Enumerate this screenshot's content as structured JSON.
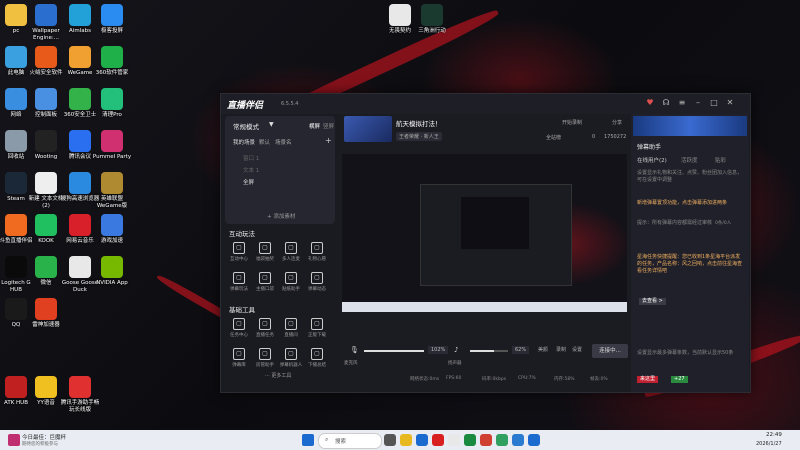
{
  "desktop": {
    "icons": [
      {
        "label": "pc",
        "icon": "folder-icon",
        "color": "#f0c040"
      },
      {
        "label": "Wallpaper Engine:...",
        "icon": "wallpaper-engine-icon",
        "color": "#2a6fd0"
      },
      {
        "label": "Aimlabs",
        "icon": "aimlabs-icon",
        "color": "#22a0d8"
      },
      {
        "label": "极客投屏",
        "icon": "screencast-icon",
        "color": "#2a8cf0"
      },
      {
        "label": "此电脑",
        "icon": "computer-icon",
        "color": "#3aa0e0"
      },
      {
        "label": "火绒安全软件",
        "icon": "huorong-icon",
        "color": "#e85a1a"
      },
      {
        "label": "WeGame",
        "icon": "wegame-icon",
        "color": "#f0a030"
      },
      {
        "label": "360软件管家",
        "icon": "360-manager-icon",
        "color": "#1fb04a"
      },
      {
        "label": "网络",
        "icon": "network-icon",
        "color": "#3a8ee0"
      },
      {
        "label": "控制面板",
        "icon": "control-panel-icon",
        "color": "#4a90e2"
      },
      {
        "label": "360安全卫士",
        "icon": "360-security-icon",
        "color": "#33b24a"
      },
      {
        "label": "清理Pro",
        "icon": "cleaner-icon",
        "color": "#22c07a"
      },
      {
        "label": "回收站",
        "icon": "recycle-bin-icon",
        "color": "#8a9aa8"
      },
      {
        "label": "Wooting",
        "icon": "wooting-icon",
        "color": "#222"
      },
      {
        "label": "腾讯会议",
        "icon": "tencent-meeting-icon",
        "color": "#2a6ff0"
      },
      {
        "label": "Pummel Party",
        "icon": "pummel-party-icon",
        "color": "#d03070"
      },
      {
        "label": "Steam",
        "icon": "steam-icon",
        "color": "#1b2838"
      },
      {
        "label": "新建 文本文档 (2)",
        "icon": "text-file-icon",
        "color": "#eee"
      },
      {
        "label": "搜狗高速浏览器",
        "icon": "sogou-browser-icon",
        "color": "#2a8ae0"
      },
      {
        "label": "英雄联盟WeGame版",
        "icon": "lol-icon",
        "color": "#b08a30"
      },
      {
        "label": "斗鱼直播伴侣",
        "icon": "douyu-icon",
        "color": "#f06a20"
      },
      {
        "label": "KOOK",
        "icon": "kook-icon",
        "color": "#20c060"
      },
      {
        "label": "网易云音乐",
        "icon": "netease-music-icon",
        "color": "#d8202a"
      },
      {
        "label": "游戏加速",
        "icon": "game-boost-icon",
        "color": "#3a7ae0"
      },
      {
        "label": "Logitech G HUB",
        "icon": "logitech-icon",
        "color": "#0a0a0a"
      },
      {
        "label": "微信",
        "icon": "wechat-icon",
        "color": "#2ab24a"
      },
      {
        "label": "Goose Goose Duck",
        "icon": "goose-icon",
        "color": "#e8e8e8"
      },
      {
        "label": "NVIDIA App",
        "icon": "nvidia-icon",
        "color": "#76b900"
      },
      {
        "label": "QQ",
        "icon": "qq-icon",
        "color": "#1a1a1a"
      },
      {
        "label": "雷神加速器",
        "icon": "leishen-icon",
        "color": "#e04020"
      },
      {
        "label": "ATK HUB",
        "icon": "atk-hub-icon",
        "color": "#c02020"
      },
      {
        "label": "YY语音",
        "icon": "yy-icon",
        "color": "#f0c020"
      },
      {
        "label": "腾讯手游助手畅玩长线版",
        "icon": "tencent-mobile-icon",
        "color": "#e03030"
      },
      {
        "label": "无畏契约",
        "icon": "valorant-icon",
        "color": "#e8e8e8"
      },
      {
        "label": "三角洲行动",
        "icon": "delta-force-icon",
        "color": "#1a3a30"
      }
    ]
  },
  "app": {
    "title": "直播伴侣",
    "version": "6.5.5.4",
    "window_buttons": [
      "gift-icon",
      "headset-icon",
      "menu-icon",
      "minimize-icon",
      "maximize-icon",
      "close-icon"
    ],
    "left": {
      "mode_label": "常规模式",
      "tab_horizontal": "横屏",
      "tab_vertical": "竖屏",
      "scene_tabs": [
        "我的场景",
        "默认",
        "场景名"
      ],
      "scenes": [
        "窗口 1",
        "文本 1",
        "全屏"
      ],
      "add_material": "+ 添加素材",
      "interactive_title": "互动玩法",
      "interactive_tools": [
        {
          "label": "互动中心",
          "icon": "interaction-icon"
        },
        {
          "label": "福袋抽奖",
          "icon": "lucky-bag-icon"
        },
        {
          "label": "多人连麦",
          "icon": "co-host-icon"
        },
        {
          "label": "礼物心愿",
          "icon": "gift-wish-icon"
        },
        {
          "label": "弹幕玩法",
          "icon": "danmu-play-icon"
        },
        {
          "label": "主播口袋",
          "icon": "pocket-icon"
        },
        {
          "label": "贴纸助手",
          "icon": "sticker-icon"
        },
        {
          "label": "弹幕动态",
          "icon": "danmu-dynamic-icon"
        }
      ],
      "basic_title": "基础工具",
      "basic_tools": [
        {
          "label": "任务中心",
          "icon": "task-icon"
        },
        {
          "label": "直播任务",
          "icon": "live-task-icon"
        },
        {
          "label": "直播间",
          "icon": "room-icon"
        },
        {
          "label": "正版下载",
          "icon": "download-icon"
        },
        {
          "label": "弹幕库",
          "icon": "danmu-lib-icon"
        },
        {
          "label": "房管助手",
          "icon": "admin-icon"
        },
        {
          "label": "弹幕机器人",
          "icon": "bot-icon"
        },
        {
          "label": "下播总结",
          "icon": "summary-icon"
        }
      ],
      "more_tools": "··· 更多工具",
      "badge": "1"
    },
    "center": {
      "stream_title": "航天模拟打法！",
      "category": "王者荣耀 · 新人王",
      "live_share": "全站榜",
      "likes": "0",
      "viewers": "1750272",
      "start_record": "开始录制",
      "share": "分享",
      "mic_label": "麦克风",
      "mic_volume": "102%",
      "speaker_label": "扬声器",
      "speaker_volume": "62%",
      "beauty_label": "美颜",
      "record_label": "录制",
      "settings_label": "设置",
      "connect_button": "连接中...",
      "status": [
        "网络状态:0ms",
        "FPS:60",
        "码率:0kbps",
        "CPU:7%",
        "内存:58%",
        "帧丢:0%"
      ]
    },
    "right": {
      "panel_title": "弹幕助手",
      "tabs": [
        "在线用户(2)",
        "活跃度",
        "贴彩"
      ],
      "messages": [
        {
          "text": "设置显示礼物和关注、点赞、粉丝团加入信息，可在设置中调整",
          "color": "#888"
        },
        {
          "text": "新增弹幕置顶功能，点击弹幕添加进两条",
          "color": "#f0b060"
        },
        {
          "text": "提示：所有弹幕内容都需经过审核",
          "color": "#888"
        },
        {
          "text": "星海任务快捷提醒：您已收到1条星海平台派发的任务，产品名称：风之回响，点击前往星海查看任务详情吧",
          "color": "#f0b060"
        },
        {
          "text": "去查看 >",
          "color": "#fff"
        },
        {
          "text": "设置显示最多弹幕条数，当前默认显示50条",
          "color": "#888"
        },
        {
          "text": "来这里",
          "color": "#fff"
        },
        {
          "text": "+27",
          "color": "#fff"
        }
      ],
      "input_placeholder": "弹幕助手",
      "danmu_count": "0条/0人"
    }
  },
  "taskbar": {
    "weather_title": "今日最佳：巨魔杯",
    "weather_sub": "期待您的积极参与",
    "search_placeholder": "搜索",
    "time": "22:49",
    "date": "2026/1/27"
  }
}
